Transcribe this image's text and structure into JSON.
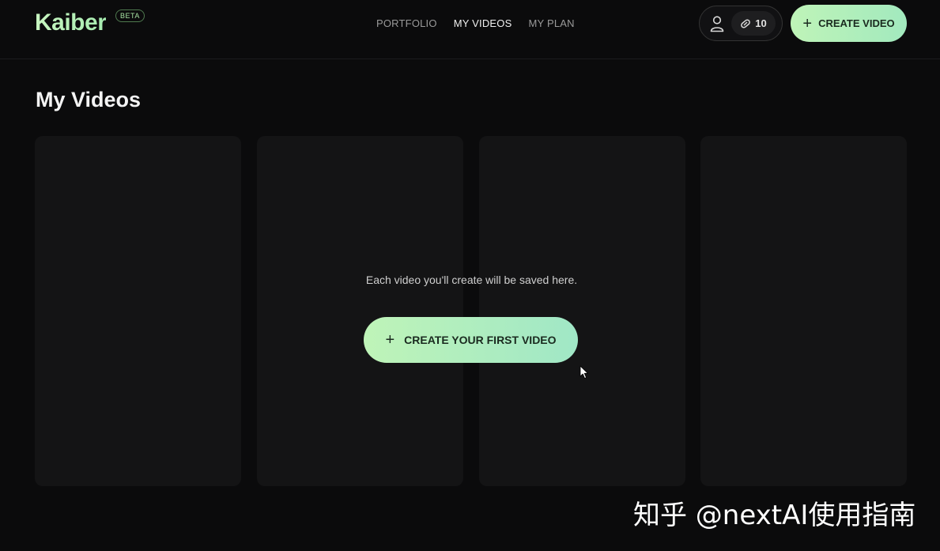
{
  "header": {
    "logo": "Kaiber",
    "beta_badge": "BETA",
    "nav": [
      {
        "label": "PORTFOLIO",
        "active": false
      },
      {
        "label": "MY VIDEOS",
        "active": true
      },
      {
        "label": "MY PLAN",
        "active": false
      }
    ],
    "credits": "10",
    "create_label": "CREATE VIDEO"
  },
  "main": {
    "title": "My Videos",
    "empty_message": "Each video you'll create will be saved here.",
    "first_video_label": "CREATE YOUR FIRST VIDEO"
  },
  "watermark": "知乎 @nextAI使用指南",
  "colors": {
    "accent_start": "#bff4b8",
    "accent_end": "#a2e9be",
    "background": "#0b0b0c",
    "card": "#141415"
  },
  "icons": [
    "user-icon",
    "credits-icon",
    "plus-icon",
    "cursor-icon"
  ]
}
